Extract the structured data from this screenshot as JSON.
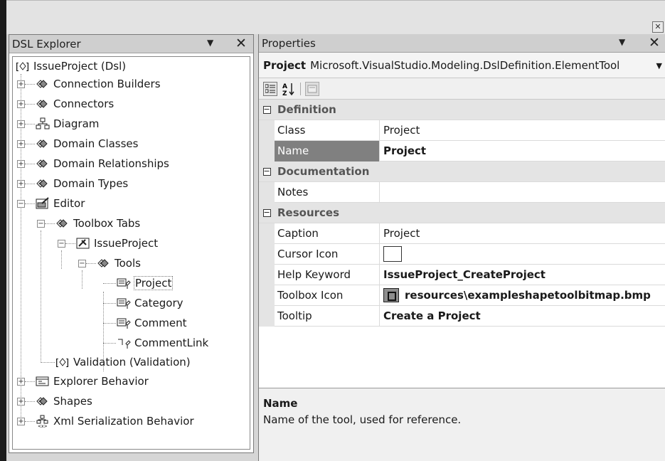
{
  "explorer": {
    "title": "DSL Explorer",
    "root": "IssueProject (Dsl)",
    "items": {
      "connection_builders": "Connection Builders",
      "connectors": "Connectors",
      "diagram": "Diagram",
      "domain_classes": "Domain Classes",
      "domain_relationships": "Domain Relationships",
      "domain_types": "Domain Types",
      "editor": "Editor",
      "toolbox_tabs": "Toolbox Tabs",
      "issueproject": "IssueProject",
      "tools": "Tools",
      "project": "Project",
      "category": "Category",
      "comment": "Comment",
      "commentlink": "CommentLink",
      "validation": "Validation (Validation)",
      "explorer_behavior": "Explorer Behavior",
      "shapes": "Shapes",
      "xml_serialization": "Xml Serialization Behavior"
    }
  },
  "properties": {
    "title": "Properties",
    "object_name": "Project",
    "object_type": "Microsoft.VisualStudio.Modeling.DslDefinition.ElementTool",
    "sort_label": "A Z",
    "categories": {
      "definition": "Definition",
      "documentation": "Documentation",
      "resources": "Resources"
    },
    "rows": {
      "class": {
        "name": "Class",
        "value": "Project"
      },
      "name": {
        "name": "Name",
        "value": "Project"
      },
      "notes": {
        "name": "Notes",
        "value": ""
      },
      "caption": {
        "name": "Caption",
        "value": "Project"
      },
      "cursor_icon": {
        "name": "Cursor Icon",
        "value": ""
      },
      "help_keyword": {
        "name": "Help Keyword",
        "value": "IssueProject_CreateProject"
      },
      "toolbox_icon": {
        "name": "Toolbox Icon",
        "value": "resources\\exampleshapetoolbitmap.bmp"
      },
      "tooltip": {
        "name": "Tooltip",
        "value": "Create a Project"
      }
    },
    "description": {
      "name": "Name",
      "text": "Name of the tool, used for reference."
    }
  },
  "colors": {
    "selected_row": "#808080",
    "category_bg": "#e4e4e4",
    "frame": "#1b1b1b"
  }
}
